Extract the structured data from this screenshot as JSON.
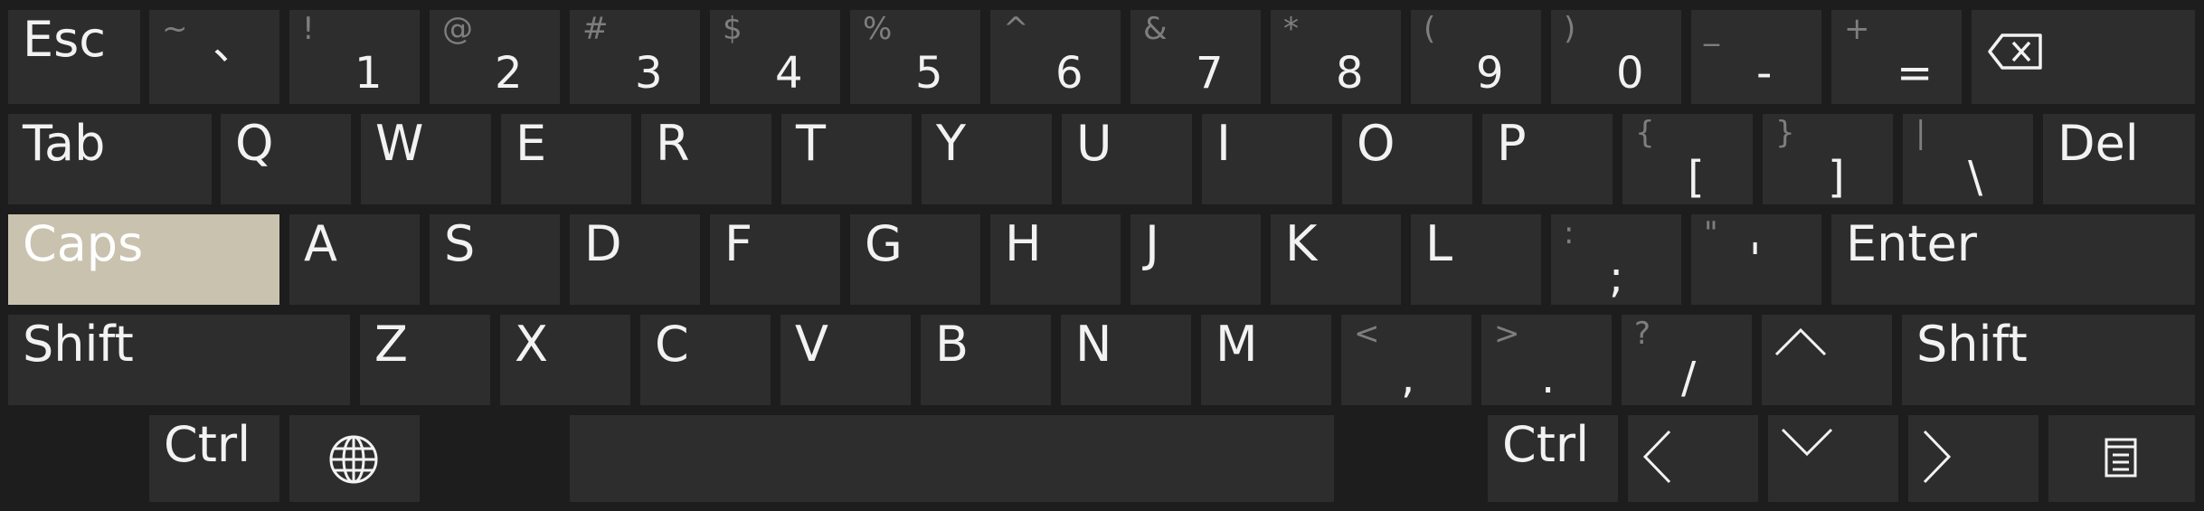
{
  "keyboard": {
    "colors": {
      "background": "#1d1d1d",
      "key": "#2d2d2d",
      "key_active": "#c9c2ae",
      "text": "#f2f2f2",
      "secondary_text": "#7e7e7e"
    },
    "row1": {
      "esc": "Esc",
      "backtick": {
        "shift": "~",
        "main": "、"
      },
      "k1": {
        "shift": "!",
        "main": "1"
      },
      "k2": {
        "shift": "@",
        "main": "2"
      },
      "k3": {
        "shift": "#",
        "main": "3"
      },
      "k4": {
        "shift": "$",
        "main": "4"
      },
      "k5": {
        "shift": "%",
        "main": "5"
      },
      "k6": {
        "shift": "^",
        "main": "6"
      },
      "k7": {
        "shift": "&",
        "main": "7"
      },
      "k8": {
        "shift": "*",
        "main": "8"
      },
      "k9": {
        "shift": "(",
        "main": "9"
      },
      "k0": {
        "shift": ")",
        "main": "0"
      },
      "minus": {
        "shift": "_",
        "main": "-"
      },
      "equals": {
        "shift": "+",
        "main": "="
      },
      "backspace_icon": "backspace-icon"
    },
    "row2": {
      "tab": "Tab",
      "letters": [
        "Q",
        "W",
        "E",
        "R",
        "T",
        "Y",
        "U",
        "I",
        "O",
        "P"
      ],
      "lbracket": {
        "shift": "{",
        "main": "["
      },
      "rbracket": {
        "shift": "}",
        "main": "]"
      },
      "backslash": {
        "shift": "|",
        "main": "\\"
      },
      "del": "Del"
    },
    "row3": {
      "caps": "Caps",
      "caps_active": true,
      "letters": [
        "A",
        "S",
        "D",
        "F",
        "G",
        "H",
        "J",
        "K",
        "L"
      ],
      "semicolon": {
        "shift": ":",
        "main": ";"
      },
      "quote": {
        "shift": "\"",
        "main": "'"
      },
      "enter": "Enter"
    },
    "row4": {
      "shift_left": "Shift",
      "letters": [
        "Z",
        "X",
        "C",
        "V",
        "B",
        "N",
        "M"
      ],
      "comma": {
        "shift": "<",
        "main": ","
      },
      "period": {
        "shift": ">",
        "main": "."
      },
      "slash": {
        "shift": "?",
        "main": "/"
      },
      "up_icon": "arrow-up-icon",
      "shift_right": "Shift"
    },
    "row5": {
      "ctrl_left": "Ctrl",
      "globe_icon": "globe-icon",
      "space": "",
      "ctrl_right": "Ctrl",
      "left_icon": "arrow-left-icon",
      "down_icon": "arrow-down-icon",
      "right_icon": "arrow-right-icon",
      "menu_icon": "menu-icon"
    }
  }
}
